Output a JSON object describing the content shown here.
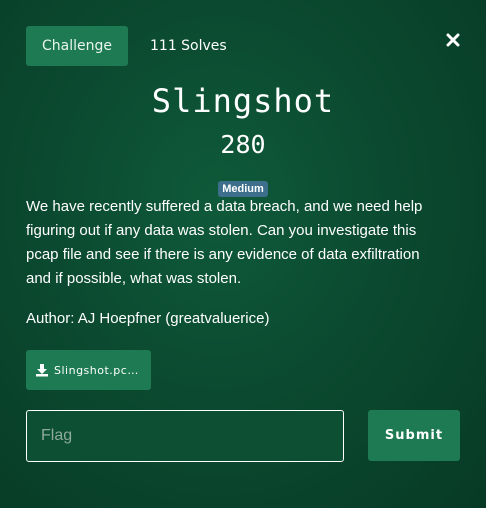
{
  "tabs": {
    "challenge_label": "Challenge",
    "solves_label": "111 Solves"
  },
  "challenge": {
    "name": "Slingshot",
    "points": "280",
    "difficulty": "Medium",
    "description": "We have recently suffered a data breach, and we need help figuring out if any data was stolen. Can you investigate this pcap file and see if there is any evidence of data exfiltration and if possible, what was stolen.",
    "author": "Author: AJ Hoepfner (greatvaluerice)"
  },
  "file": {
    "name": "Slingshot.pcap",
    "icon": "download-icon"
  },
  "flag_form": {
    "placeholder": "Flag",
    "value": "",
    "submit_label": "Submit"
  },
  "colors": {
    "background": "#0b4a30",
    "button": "#1d7a52",
    "badge": "#3d6f8c"
  }
}
